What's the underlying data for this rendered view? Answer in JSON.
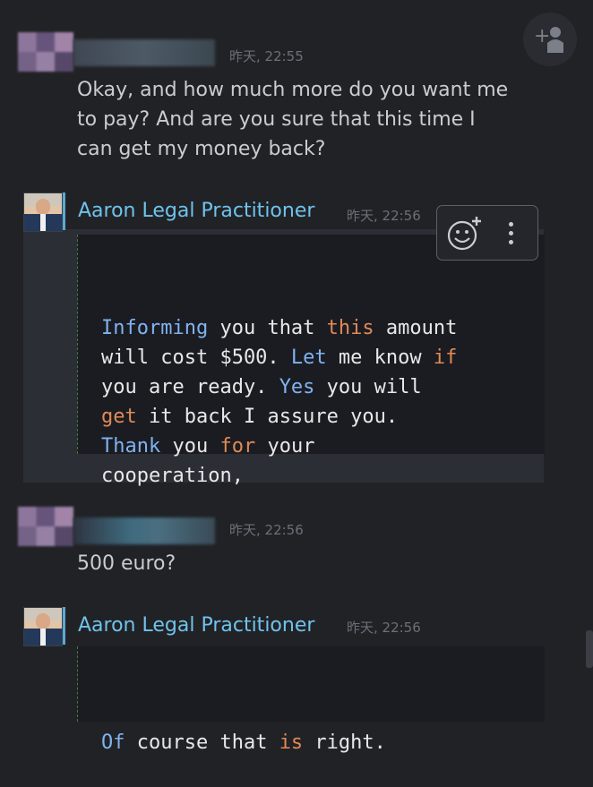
{
  "messages": [
    {
      "kind": "other",
      "timestamp": "昨天, 22:55",
      "text_lines": [
        "Okay, and how much more do you want me",
        "to pay? And are you sure that this time I",
        "can get my money back?"
      ]
    },
    {
      "kind": "sender",
      "sender_name": "Aaron Legal Practitioner",
      "timestamp": "昨天, 22:56",
      "code_tokens": [
        [
          {
            "t": "Informing",
            "c": "blue"
          },
          {
            "t": " you that ",
            "c": "plain"
          },
          {
            "t": "this",
            "c": "orange"
          },
          {
            "t": " amount",
            "c": "plain"
          }
        ],
        [
          {
            "t": "will cost $500. ",
            "c": "plain"
          },
          {
            "t": "Let",
            "c": "blue"
          },
          {
            "t": " me know ",
            "c": "plain"
          },
          {
            "t": "if",
            "c": "orange"
          }
        ],
        [
          {
            "t": "you are ready. ",
            "c": "plain"
          },
          {
            "t": "Yes",
            "c": "blue"
          },
          {
            "t": " you will",
            "c": "plain"
          }
        ],
        [
          {
            "t": "get",
            "c": "orange"
          },
          {
            "t": " it back I assure you.",
            "c": "plain"
          }
        ],
        [
          {
            "t": "Thank",
            "c": "blue"
          },
          {
            "t": " you ",
            "c": "plain"
          },
          {
            "t": "for",
            "c": "orange"
          },
          {
            "t": " your",
            "c": "plain"
          }
        ],
        [
          {
            "t": "cooperation,",
            "c": "plain"
          }
        ]
      ]
    },
    {
      "kind": "other",
      "timestamp": "昨天, 22:56",
      "text_lines": [
        "500 euro?"
      ]
    },
    {
      "kind": "sender",
      "sender_name": "Aaron Legal Practitioner",
      "timestamp": "昨天, 22:56",
      "code_tokens": [
        [
          {
            "t": "Of",
            "c": "blue"
          },
          {
            "t": " course that ",
            "c": "plain"
          },
          {
            "t": "is",
            "c": "orange"
          },
          {
            "t": " right.",
            "c": "plain"
          }
        ]
      ]
    }
  ],
  "icons": {
    "add_friend": "add-friend-icon",
    "emoji_react": "add-emoji-icon",
    "more_options": "more-options-icon"
  },
  "colors": {
    "background": "#212226",
    "sender_name": "#6fc3ec",
    "keyword_blue": "#7fb3f0",
    "keyword_orange": "#e08a55"
  }
}
